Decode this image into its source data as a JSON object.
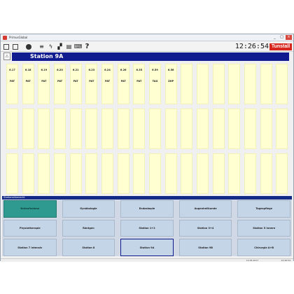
{
  "window": {
    "title": "PrimusGlobal"
  },
  "header": {
    "clock": "12:26:54",
    "brand": "Tunstall"
  },
  "station": {
    "name": "Station 9A"
  },
  "toolbar": {
    "icons": [
      "panel-icon",
      "list-icon",
      "bell-icon",
      "user-icon",
      "signal-icon",
      "chart-icon",
      "printer-icon",
      "keyboard-icon",
      "help-icon"
    ]
  },
  "grid": {
    "columns": 18,
    "cells": [
      {
        "num": "6.17",
        "type": "PAT"
      },
      {
        "num": "6.18",
        "type": "PAT"
      },
      {
        "num": "6.19",
        "type": "PAT"
      },
      {
        "num": "6.20",
        "type": "PAT"
      },
      {
        "num": "6.21",
        "type": "PAT"
      },
      {
        "num": "6.23",
        "type": "PAT"
      },
      {
        "num": "6.24",
        "type": "PAT"
      },
      {
        "num": "6.26",
        "type": "PAT"
      },
      {
        "num": "6.35",
        "type": "PAT"
      },
      {
        "num": "6.59",
        "type": "TAG"
      },
      {
        "num": "6.56",
        "type": "ZHP"
      }
    ]
  },
  "zones": {
    "header": "Stationsübersicht",
    "buttons": [
      "Notaufnahme",
      "Gynäkologie",
      "Endoskopie",
      "Augenheilkunde",
      "Tagespflege",
      "Physiotherapie",
      "Röntgen",
      "Station 1+2",
      "Station 3+4",
      "Station 5 Innere",
      "Station 7 Intensiv",
      "Station 8",
      "Station 9A",
      "Station 9B",
      "Chirurgie A+B"
    ]
  },
  "statusbar": {
    "date": "12.05.2017",
    "time": "12:26:54"
  }
}
